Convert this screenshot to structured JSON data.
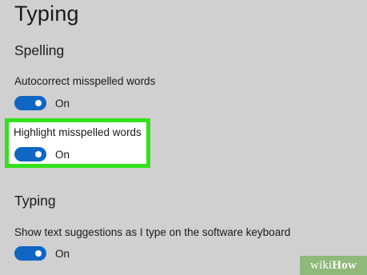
{
  "page": {
    "title": "Typing"
  },
  "spelling": {
    "title": "Spelling",
    "autocorrect": {
      "label": "Autocorrect misspelled words",
      "state": "On"
    },
    "highlight": {
      "label": "Highlight misspelled words",
      "state": "On"
    }
  },
  "typing": {
    "title": "Typing",
    "suggestions": {
      "label": "Show text suggestions as I type on the software keyboard",
      "state": "On"
    }
  },
  "watermark": {
    "prefix": "wiki",
    "suffix": "How"
  },
  "colors": {
    "toggle_on": "#0f66c4",
    "highlight_border": "#33e21d",
    "background": "#d0d0d0",
    "watermark_bg": "#8fb87a"
  }
}
